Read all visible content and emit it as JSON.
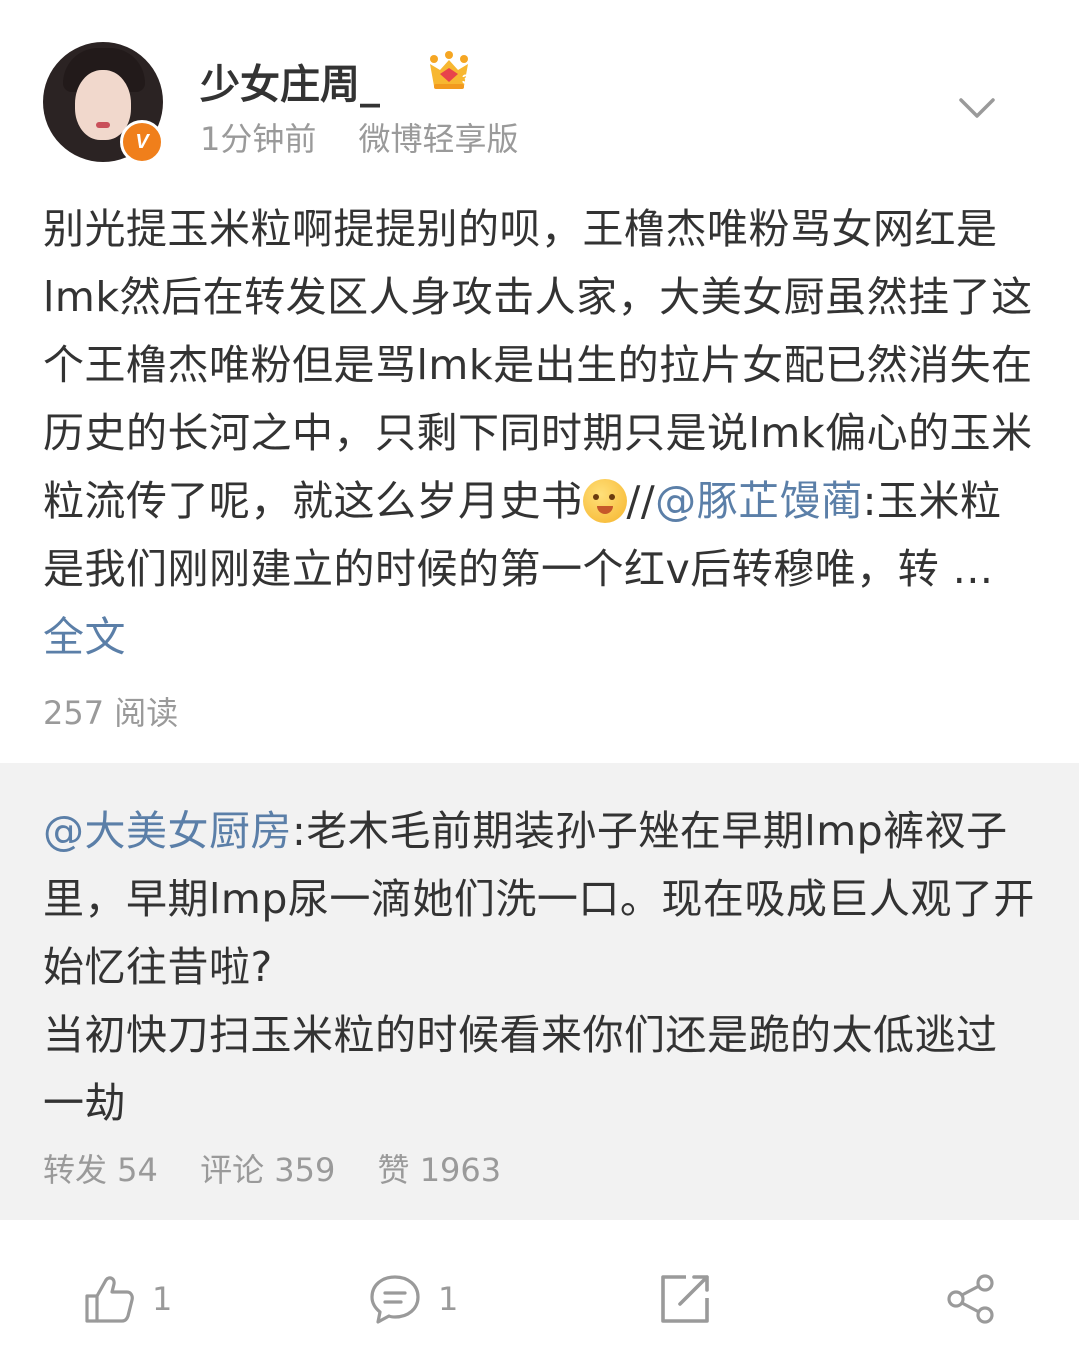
{
  "post": {
    "username": "少女庄周_",
    "time": "1分钟前",
    "source": "微博轻享版",
    "verified_badge": "V",
    "text_part1": "别光提玉米粒啊提提别的呗，王橹杰唯粉骂女网红是lmk然后在转发区人身攻击人家，大美女厨虽然挂了这个王橹杰唯粉但是骂lmk是出生的拉片女配已然消失在历史的长河之中，只剩下同时期只是说lmk偏心的玉米粒流传了呢，就这么岁月史书",
    "separator": "//",
    "mention": "@豚芷馒蔺",
    "text_part2": ":玉米粒是我们刚刚建立的时候的第一个红v后转穆唯，转",
    "ellipsis": " ... ",
    "full_text_link": "全文",
    "reads": "257 阅读"
  },
  "retweet": {
    "mention": "@大美女厨房",
    "text": ":老木毛前期装孙子矬在早期lmp裤衩子里，早期lmp尿一滴她们洗一口。现在吸成巨人观了开始忆往昔啦?",
    "text2": "当初快刀扫玉米粒的时候看来你们还是跪的太低逃过一劫",
    "reposts": "转发 54",
    "comments": "评论 359",
    "likes": "赞 1963"
  },
  "actions": {
    "like_count": "1",
    "comment_count": "1"
  },
  "colors": {
    "link": "#5b7fa8",
    "secondary_text": "#9a9a9a",
    "quote_bg": "#f2f2f2",
    "badge": "#f07f1b"
  },
  "icons": [
    "crown-badge-icon",
    "chevron-down-icon",
    "emoji-icon",
    "like-icon",
    "comment-icon",
    "repost-icon",
    "share-icon"
  ]
}
